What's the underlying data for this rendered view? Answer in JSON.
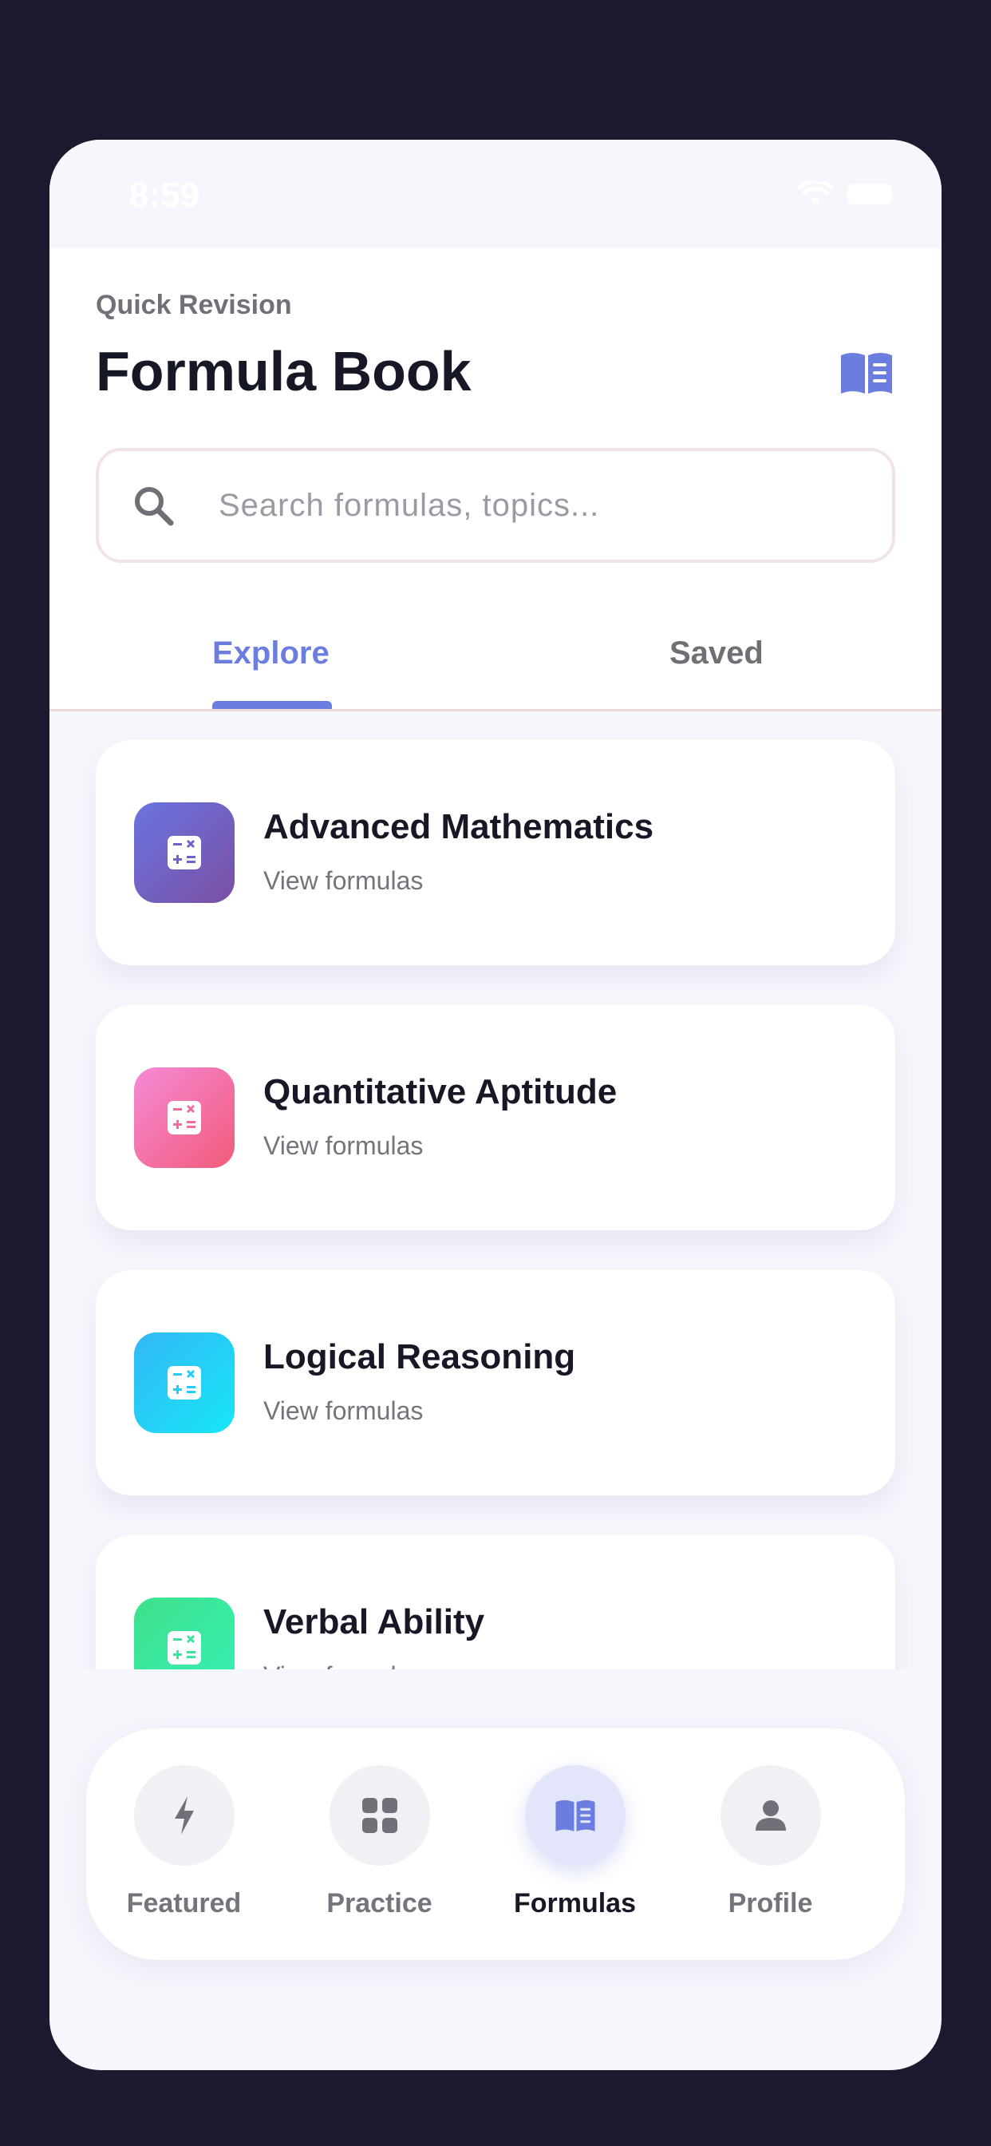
{
  "status": {
    "time": "8:59"
  },
  "header": {
    "eyebrow": "Quick Revision",
    "title": "Formula Book"
  },
  "search": {
    "placeholder": "Search formulas, topics..."
  },
  "tabs": [
    {
      "label": "Explore",
      "active": true
    },
    {
      "label": "Saved",
      "active": false
    }
  ],
  "categories": [
    {
      "title": "Advanced Mathematics",
      "subtitle": "View formulas",
      "gradient": [
        "#6b74e0",
        "#7a4fa4"
      ],
      "icon": "calculator-icon"
    },
    {
      "title": "Quantitative Aptitude",
      "subtitle": "View formulas",
      "gradient": [
        "#f58ad6",
        "#f25b7a"
      ],
      "icon": "calculator-icon"
    },
    {
      "title": "Logical Reasoning",
      "subtitle": "View formulas",
      "gradient": [
        "#33b8f5",
        "#17e6f7"
      ],
      "icon": "calculator-icon"
    },
    {
      "title": "Verbal Ability",
      "subtitle": "View formulas",
      "gradient": [
        "#3ee08a",
        "#35f1b5"
      ],
      "icon": "calculator-icon"
    }
  ],
  "nav": [
    {
      "label": "Featured",
      "icon": "bolt-icon",
      "active": false
    },
    {
      "label": "Practice",
      "icon": "grid-icon",
      "active": false
    },
    {
      "label": "Formulas",
      "icon": "book-icon",
      "active": true
    },
    {
      "label": "Profile",
      "icon": "user-icon",
      "active": false
    }
  ],
  "colors": {
    "accent": "#6b7ee0",
    "background": "#1b1a2e"
  }
}
